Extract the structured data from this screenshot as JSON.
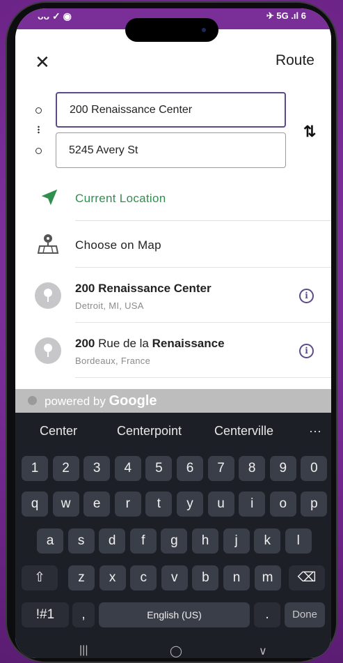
{
  "status": {
    "left": "ᴗᴗ ✓ ◉",
    "right": "✈ 5G .ıl 6"
  },
  "header": {
    "close_glyph": "✕",
    "title": "Route"
  },
  "route": {
    "from_value": "200 Renaissance Center",
    "to_value": "5245 Avery St",
    "swap_glyph": "⇅"
  },
  "options": {
    "current_location": "Current Location",
    "choose_on_map": "Choose on Map"
  },
  "suggestions": [
    {
      "bold1": "200 Renaissance Center",
      "plain": "",
      "bold2": "",
      "sub": "Detroit, MI, USA"
    },
    {
      "bold1": "200",
      "plain": " Rue de la ",
      "bold2": "Renaissance",
      "sub": "Bordeaux, France"
    }
  ],
  "info_glyph": "i",
  "powered": {
    "prefix": "powered by ",
    "brand": "Google"
  },
  "keyboard": {
    "word_suggestions": [
      "Center",
      "Centerpoint",
      "Centerville",
      "···"
    ],
    "row_numbers": [
      "1",
      "2",
      "3",
      "4",
      "5",
      "6",
      "7",
      "8",
      "9",
      "0"
    ],
    "row_top": [
      "q",
      "w",
      "e",
      "r",
      "t",
      "y",
      "u",
      "i",
      "o",
      "p"
    ],
    "row_mid": [
      "a",
      "s",
      "d",
      "f",
      "g",
      "h",
      "j",
      "k",
      "l"
    ],
    "row_bottom": [
      "z",
      "x",
      "c",
      "v",
      "b",
      "n",
      "m"
    ],
    "shift": "⇧",
    "backspace": "⌫",
    "symbols": "!#1",
    "comma": ",",
    "space": "English (US)",
    "period": ".",
    "done": "Done"
  },
  "navbar": {
    "recent": "|||",
    "home": "◯",
    "back": "∨"
  },
  "colors": {
    "accent": "#5b4a86",
    "green": "#2f8f4e",
    "frame": "#7a2f98"
  }
}
